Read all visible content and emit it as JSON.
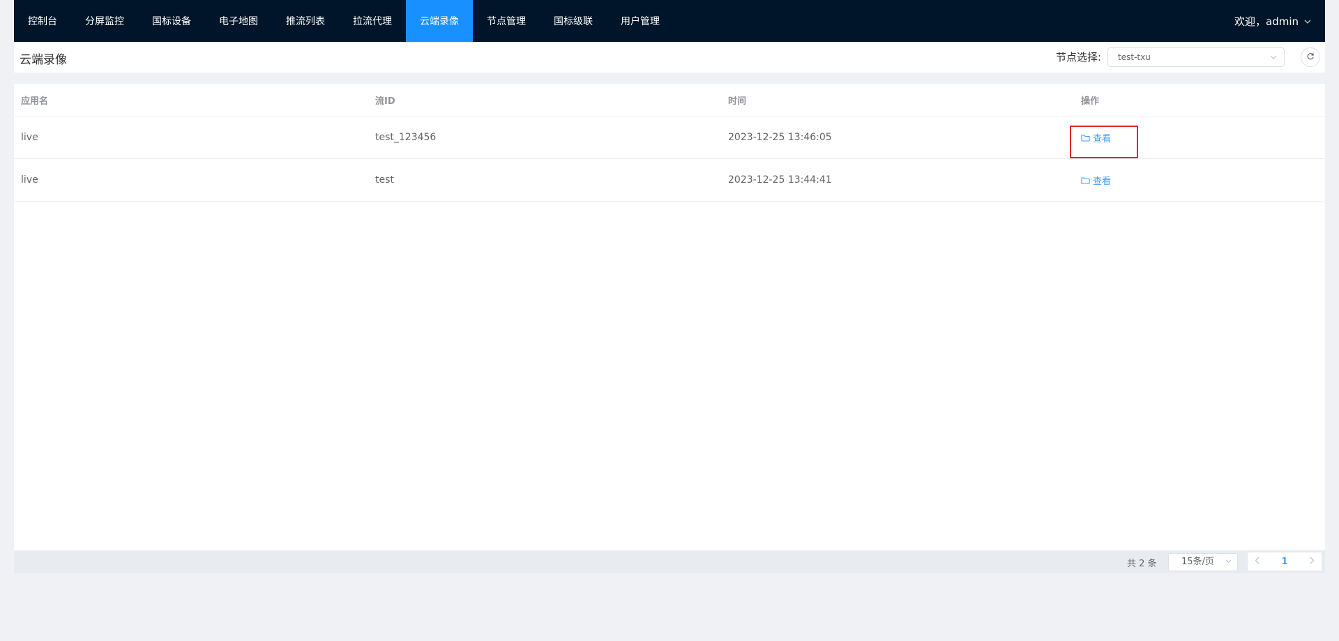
{
  "nav": {
    "items": [
      {
        "label": "控制台"
      },
      {
        "label": "分屏监控"
      },
      {
        "label": "国标设备"
      },
      {
        "label": "电子地图"
      },
      {
        "label": "推流列表"
      },
      {
        "label": "拉流代理"
      },
      {
        "label": "云端录像",
        "active": true
      },
      {
        "label": "节点管理"
      },
      {
        "label": "国标级联"
      },
      {
        "label": "用户管理"
      }
    ],
    "user_greeting": "欢迎，admin",
    "user_menu_icon": "chevron-down-icon"
  },
  "header": {
    "title": "云端录像",
    "node_label": "节点选择:",
    "node_value": "test-txu",
    "refresh_icon": "refresh-icon"
  },
  "table": {
    "columns": [
      "应用名",
      "流ID",
      "时间",
      "操作"
    ],
    "rows": [
      {
        "app": "live",
        "stream": "test_123456",
        "time": "2023-12-25 13:46:05",
        "action": "查看"
      },
      {
        "app": "live",
        "stream": "test",
        "time": "2023-12-25 13:44:41",
        "action": "查看"
      }
    ],
    "action_icon": "folder-icon"
  },
  "pagination": {
    "total_text": "共 2 条",
    "page_size": "15条/页",
    "current_page": "1"
  },
  "colors": {
    "nav_bg": "#001529",
    "active_tab": "#1890ff",
    "link": "#409eff",
    "highlight": "#e0262c"
  }
}
